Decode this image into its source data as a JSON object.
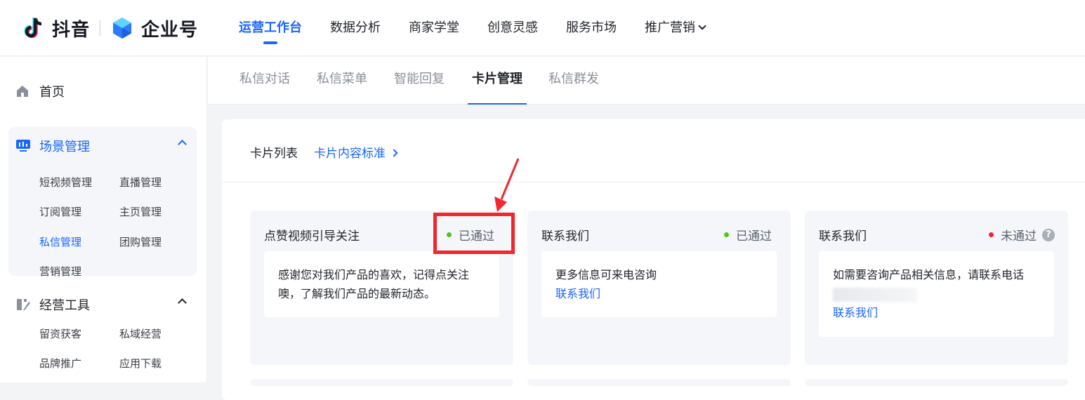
{
  "topbar": {
    "brand_name": "抖音",
    "enterprise_name": "企业号",
    "nav": [
      {
        "label": "运营工作台",
        "active": true
      },
      {
        "label": "数据分析",
        "active": false
      },
      {
        "label": "商家学堂",
        "active": false
      },
      {
        "label": "创意灵感",
        "active": false
      },
      {
        "label": "服务市场",
        "active": false
      },
      {
        "label": "推广营销",
        "active": false,
        "has_dropdown": true
      }
    ]
  },
  "sidebar": {
    "home_label": "首页",
    "groups": [
      {
        "title": "场景管理",
        "expanded": true,
        "active": true,
        "items": [
          "短视频管理",
          "直播管理",
          "订阅管理",
          "主页管理",
          "私信管理",
          "团购管理",
          "营销管理"
        ],
        "active_item": "私信管理"
      },
      {
        "title": "经营工具",
        "expanded": true,
        "active": false,
        "items": [
          "留资获客",
          "私域经营",
          "品牌推广",
          "应用下载"
        ]
      }
    ]
  },
  "tabs": [
    {
      "label": "私信对话",
      "active": false
    },
    {
      "label": "私信菜单",
      "active": false
    },
    {
      "label": "智能回复",
      "active": false
    },
    {
      "label": "卡片管理",
      "active": true
    },
    {
      "label": "私信群发",
      "active": false
    }
  ],
  "panel": {
    "title": "卡片列表",
    "standard_link": "卡片内容标准"
  },
  "cards": [
    {
      "title": "点赞视频引导关注",
      "status": "已通过",
      "status_color": "#52c41a",
      "body": "感谢您对我们产品的喜欢，记得点关注噢，了解我们产品的最新动态。",
      "link": ""
    },
    {
      "title": "联系我们",
      "status": "已通过",
      "status_color": "#52c41a",
      "body": "更多信息可来电咨询",
      "link": "联系我们"
    },
    {
      "title": "联系我们",
      "status": "未通过",
      "status_color": "#f5222d",
      "body": "如需要咨询产品相关信息，请联系电话",
      "link": "联系我们",
      "help": "?"
    }
  ],
  "colors": {
    "accent": "#1966ff",
    "annotation": "#f0282d"
  }
}
